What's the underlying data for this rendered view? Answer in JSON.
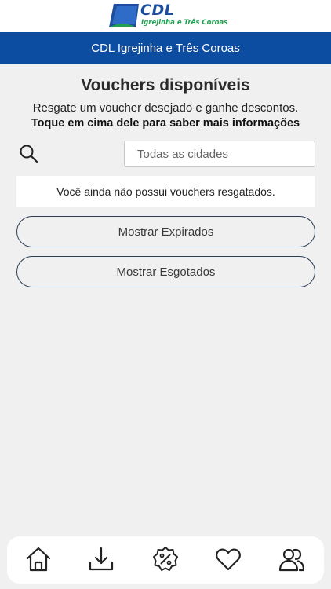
{
  "brand": {
    "name": "CDL",
    "tagline": "Igrejinha e Três Coroas",
    "colors": {
      "blue": "#1d4f9c",
      "green": "#22a052",
      "header": "#0c4da2"
    }
  },
  "header": {
    "title": "CDL Igrejinha e Três Coroas"
  },
  "main": {
    "title": "Vouchers disponíveis",
    "subtitle": "Resgate um voucher desejado e ganhe descontos.",
    "subtitle_bold": "Toque em cima dele para saber mais informações",
    "search_icon": "search-icon",
    "city_filter": {
      "value": "Todas as cidades"
    },
    "empty_message": "Você ainda não possui vouchers resgatados.",
    "show_expired_label": "Mostrar Expirados",
    "show_soldout_label": "Mostrar Esgotados"
  },
  "bottom_nav": {
    "items": [
      {
        "icon": "home-icon"
      },
      {
        "icon": "download-icon"
      },
      {
        "icon": "discount-badge-icon"
      },
      {
        "icon": "heart-icon"
      },
      {
        "icon": "users-icon"
      }
    ]
  }
}
